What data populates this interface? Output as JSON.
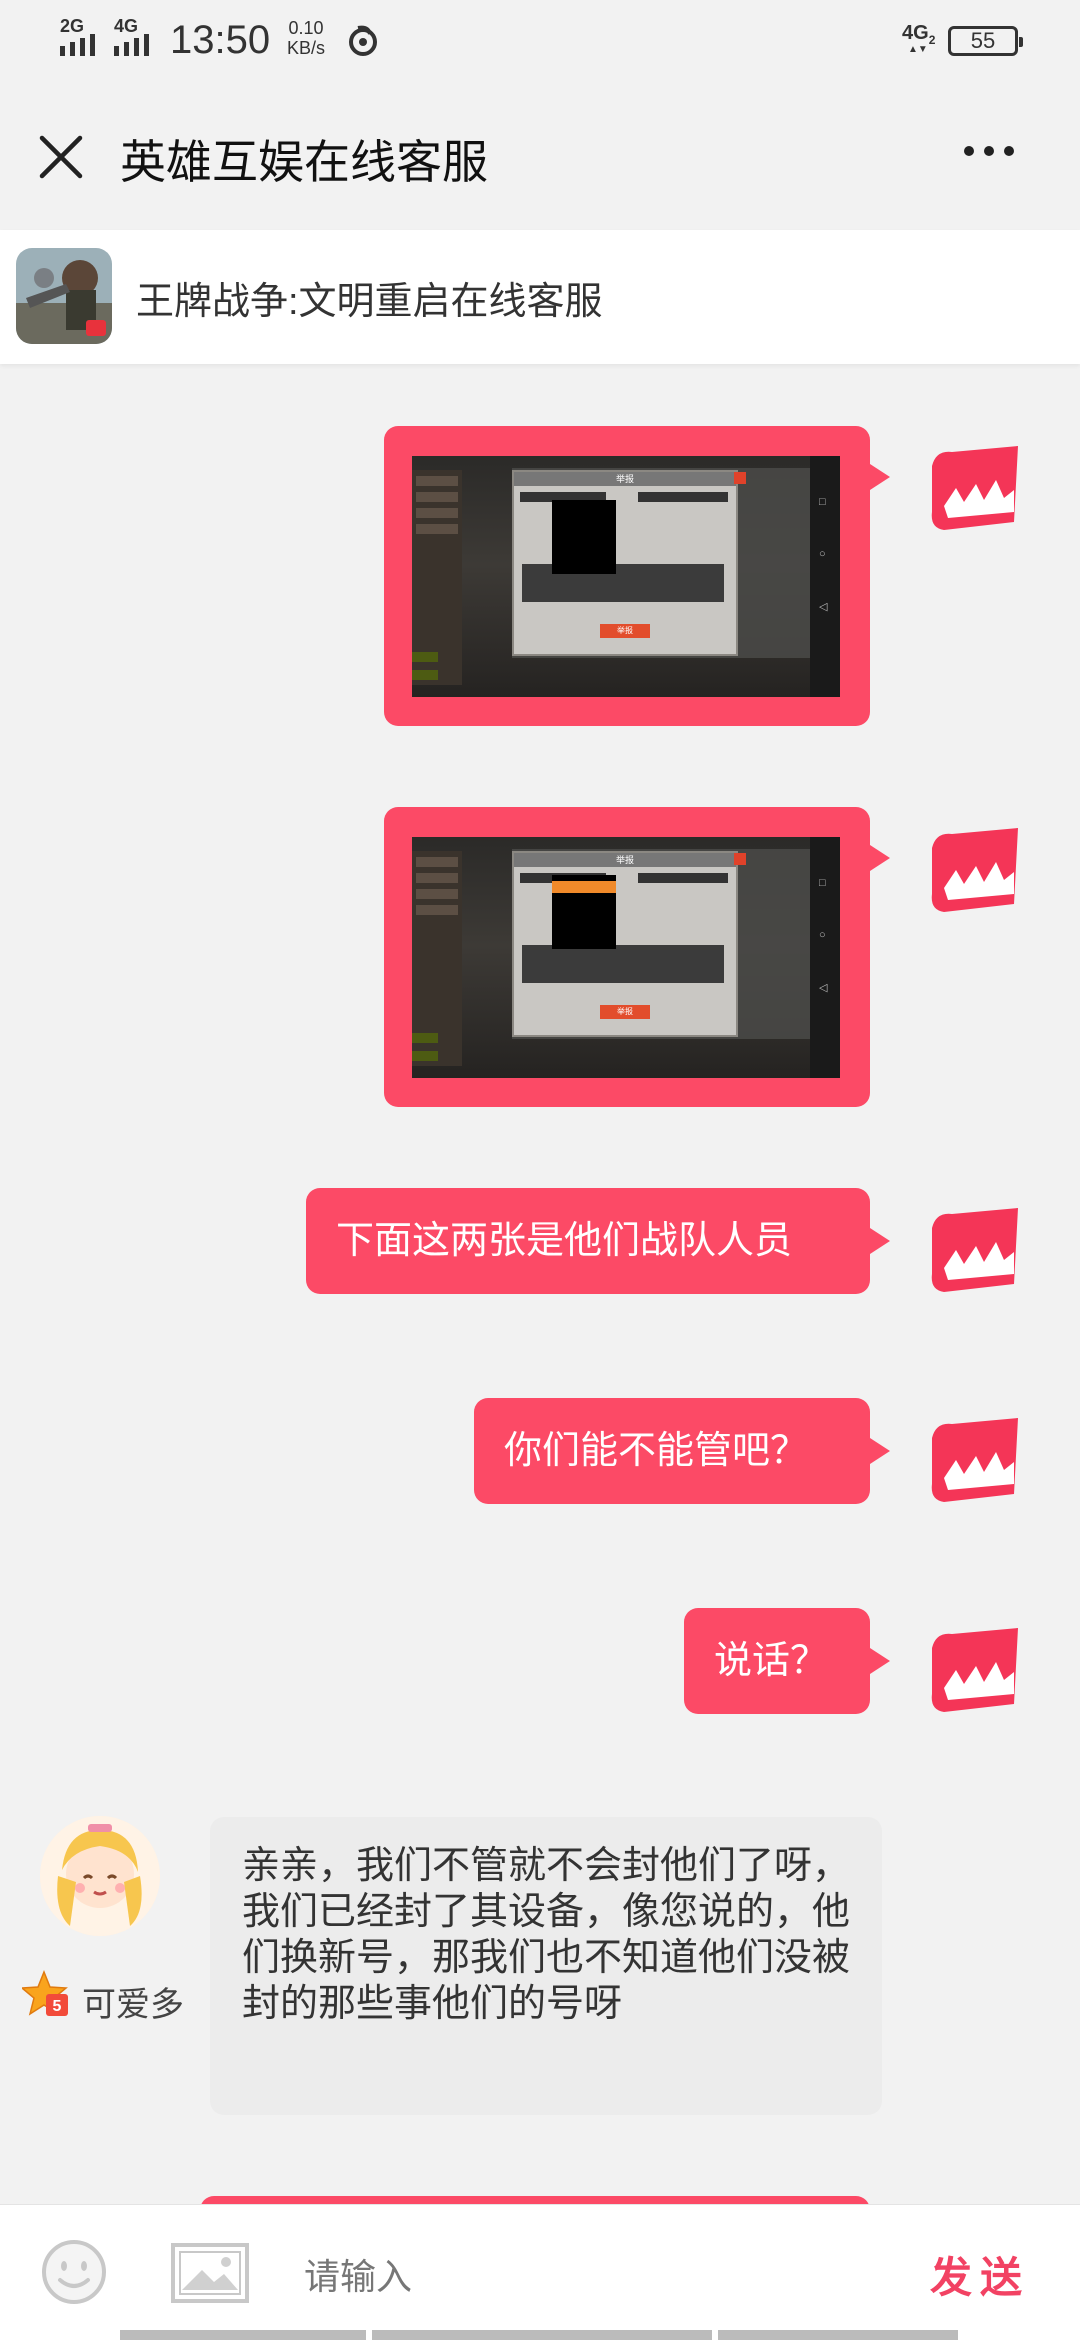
{
  "status_bar": {
    "signal1": "2G",
    "signal2": "4G",
    "time": "13:50",
    "speed_value": "0.10",
    "speed_unit": "KB/s",
    "network": "4G",
    "sim": "2",
    "battery": "55"
  },
  "nav": {
    "title": "英雄互娱在线客服"
  },
  "service": {
    "title": "王牌战争:文明重启在线客服"
  },
  "messages": {
    "user_text_1": "下面这两张是他们战队人员",
    "user_text_2": "你们能不能管吧？",
    "user_text_3": "说话？",
    "agent_name": "可爱多",
    "agent_badge": "5",
    "agent_text": "亲亲，我们不管就不会封他们了呀，我们已经封了其设备，像您说的，他们换新号，那我们也不知道他们没被封的那些事他们的号呀"
  },
  "screenshot": {
    "dialog_title": "举报",
    "submit": "举报"
  },
  "input": {
    "placeholder": "请输入",
    "send": "发送"
  },
  "colors": {
    "accent": "#fc4a66",
    "send": "#f24263"
  }
}
